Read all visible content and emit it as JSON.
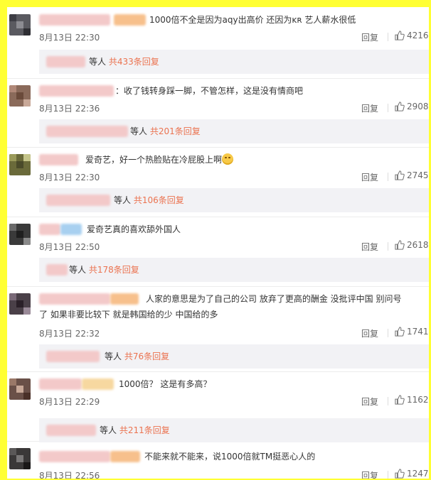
{
  "labels": {
    "reply": "回复",
    "etc": "等人",
    "count_prefix": "共",
    "count_suffix": "条回复"
  },
  "comments": [
    {
      "text": "1000倍不全是因为aqy出高价 还因为ᴋʀ 艺人薪水很低",
      "date": "8月13日 22:30",
      "likes": "4216",
      "reply_count": "433"
    },
    {
      "text": "：收了钱转身踩一脚，不管怎样，这是没有情商吧",
      "date": "8月13日 22:36",
      "likes": "2908",
      "reply_count": "201"
    },
    {
      "text": "爱奇艺，好一个热脸贴在冷屁股上啊",
      "emoji": "shy-face-emoji",
      "date": "8月13日 22:30",
      "likes": "2745",
      "reply_count": "106"
    },
    {
      "text": "爱奇艺真的喜欢舔外国人",
      "date": "8月13日 22:50",
      "likes": "2618",
      "reply_count": "178"
    },
    {
      "text_line1": "人家的意思是为了自己的公司  放弃了更高的酬金  没批评中国  别问号",
      "text_line2": "了  如果非要比较下  就是韩国给的少 中国给的多",
      "date": "8月13日 22:32",
      "likes": "1741",
      "reply_count": "76"
    },
    {
      "text": "1000倍？ 这是有多高？",
      "date": "8月13日 22:29",
      "likes": "1162",
      "reply_count": "211"
    },
    {
      "text": "不能来就不能来，说1000倍就TM挺恶心人的",
      "date": "8月13日 22:56",
      "likes": "1247"
    }
  ],
  "colors": {
    "frame": "#ffff33",
    "count_link": "#eb7350",
    "reply_box": "#f2f2f5"
  },
  "icons": {
    "like": "thumbs-up-icon"
  }
}
